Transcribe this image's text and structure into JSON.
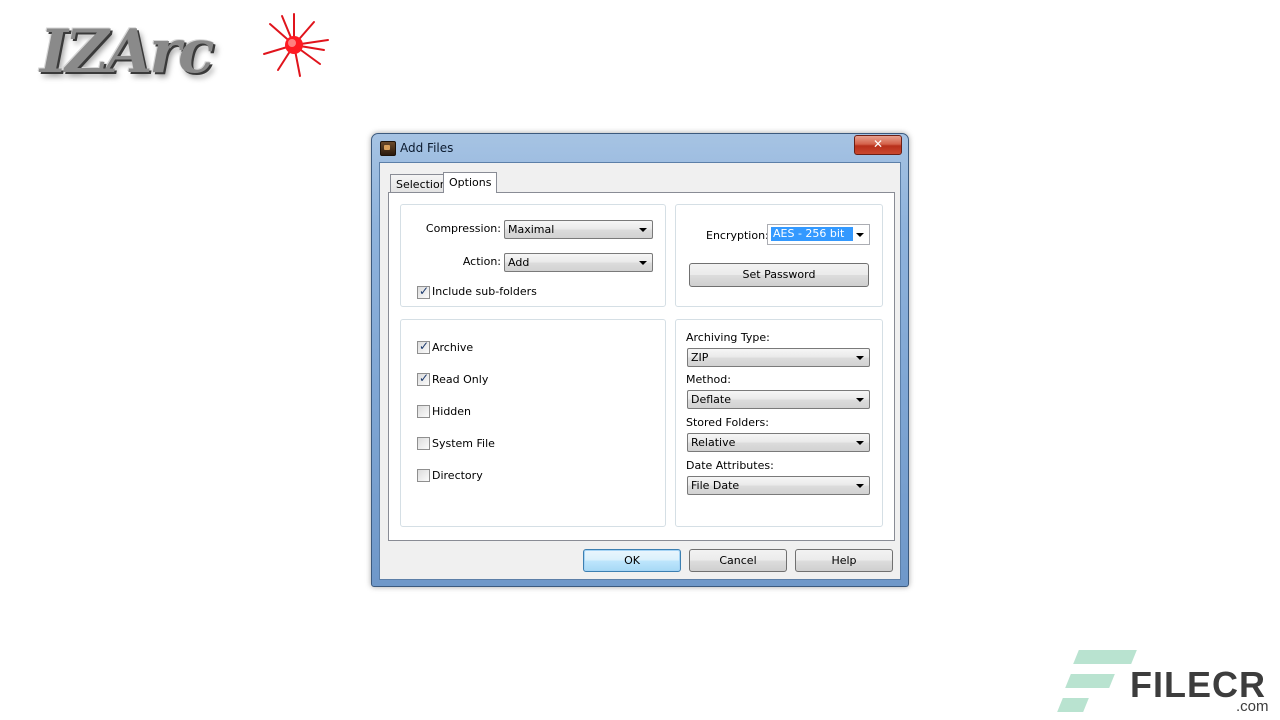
{
  "logo": {
    "text": "IZArc"
  },
  "window": {
    "title": "Add Files",
    "close_glyph": "✕"
  },
  "tabs": [
    {
      "label": "Selection",
      "selected": false
    },
    {
      "label": "Options",
      "selected": true
    }
  ],
  "compression_group": {
    "compression_label": "Compression:",
    "compression_value": "Maximal",
    "action_label": "Action:",
    "action_value": "Add",
    "include_subfolders_label": "Include sub-folders",
    "include_subfolders_checked": true
  },
  "encryption_group": {
    "encryption_label": "Encryption:",
    "encryption_value": "AES - 256 bit",
    "set_password_label": "Set Password"
  },
  "attributes_group": {
    "items": [
      {
        "label": "Archive",
        "checked": true
      },
      {
        "label": "Read Only",
        "checked": true
      },
      {
        "label": "Hidden",
        "checked": false
      },
      {
        "label": "System File",
        "checked": false
      },
      {
        "label": "Directory",
        "checked": false
      }
    ]
  },
  "archive_group": {
    "archiving_type_label": "Archiving Type:",
    "archiving_type_value": "ZIP",
    "method_label": "Method:",
    "method_value": "Deflate",
    "stored_folders_label": "Stored Folders:",
    "stored_folders_value": "Relative",
    "date_attributes_label": "Date Attributes:",
    "date_attributes_value": "File Date"
  },
  "buttons": {
    "ok": "OK",
    "cancel": "Cancel",
    "help": "Help"
  },
  "watermark": {
    "text": "FILECR",
    "suffix": ".com"
  }
}
